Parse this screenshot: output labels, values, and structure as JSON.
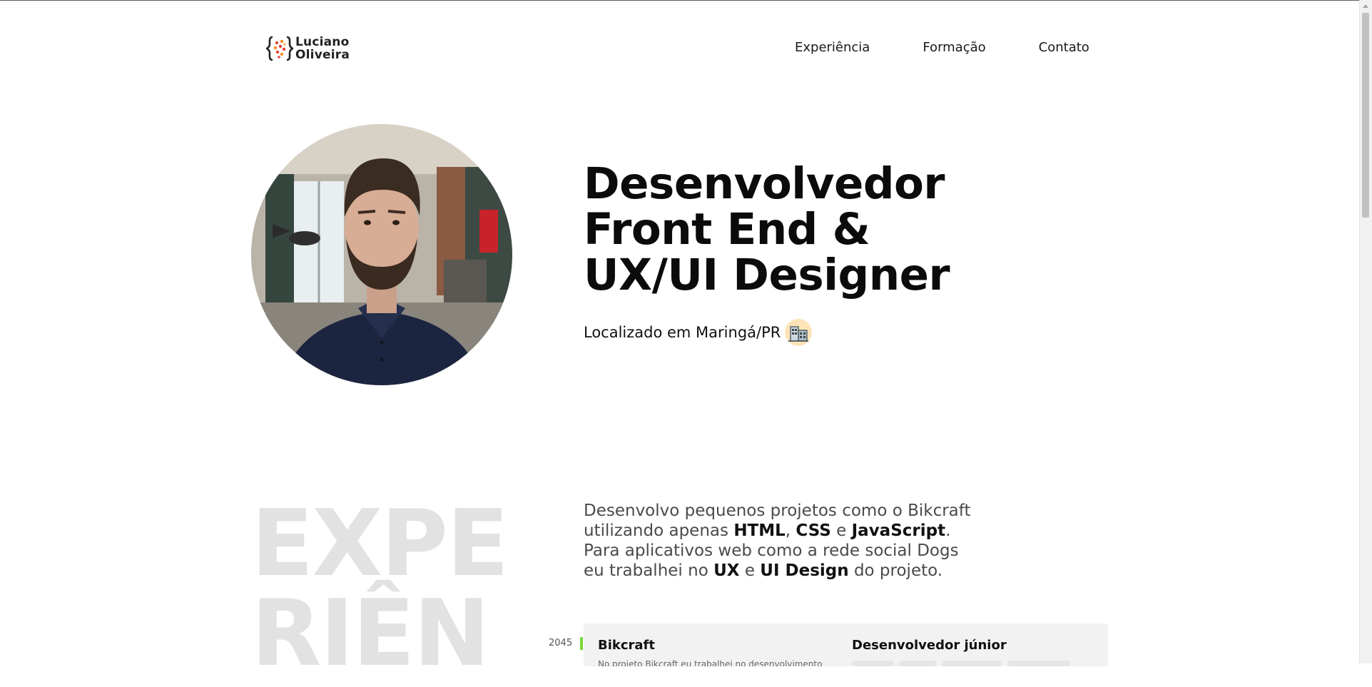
{
  "header": {
    "logo": {
      "line1": "Luciano",
      "line2": "Oliveira"
    },
    "nav": [
      "Experiência",
      "Formação",
      "Contato"
    ]
  },
  "hero": {
    "title_lines": [
      "Desenvolvedor",
      "Front End &",
      "UX/UI Designer"
    ],
    "location": "Localizado em Maringá/PR",
    "location_icon": "city-building-icon"
  },
  "experience": {
    "section_label_lines": [
      "EXPE",
      "RIÊN"
    ],
    "intro": {
      "t1": "Desenvolvo pequenos projetos como o Bikcraft utilizando apenas ",
      "html": "HTML",
      "t2": ", ",
      "css": "CSS",
      "t3": " e ",
      "js": "JavaScript",
      "t4": ". Para aplicativos web como a rede social Dogs eu trabalhei no ",
      "ux": "UX",
      "t5": " e ",
      "ui": "UI Design",
      "t6": " do projeto."
    },
    "items": [
      {
        "year": "2045",
        "company": "Bikcraft",
        "role": "Desenvolvedor júnior",
        "description": "No projeto Bikcraft eu trabalhei no desenvolvimento"
      }
    ]
  },
  "colors": {
    "accent_green": "#7bd63a",
    "section_label_gray": "#e2e2e2",
    "card_background": "#f2f2f2"
  }
}
